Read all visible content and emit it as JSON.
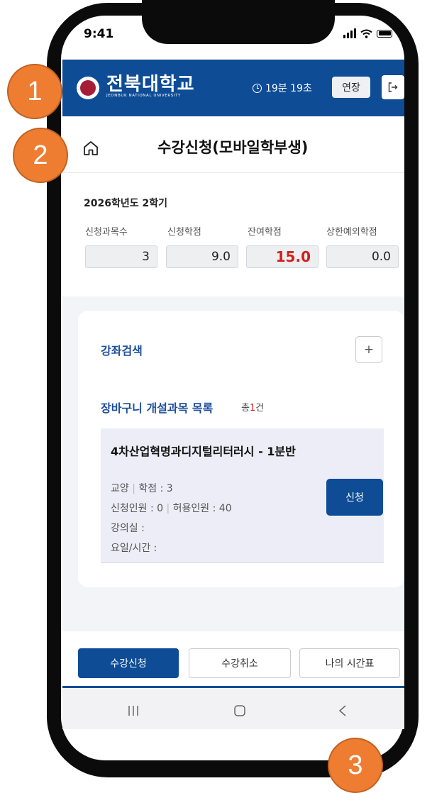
{
  "status_bar": {
    "time": "9:41"
  },
  "header": {
    "logo_name": "전북대학교",
    "logo_subtitle": "JEONBUK NATIONAL UNIVERSITY",
    "timer": "19분 19초",
    "extend_label": "연장"
  },
  "page": {
    "title": "수강신청(모바일학부생)"
  },
  "summary": {
    "semester": "2026학년도 2학기",
    "stats": [
      {
        "label": "신청과목수",
        "value": "3"
      },
      {
        "label": "신청학점",
        "value": "9.0"
      },
      {
        "label": "잔여학점",
        "value": "15.0"
      },
      {
        "label": "상한예외학점",
        "value": "0.0"
      }
    ]
  },
  "search": {
    "title": "강좌검색",
    "plus_label": "+"
  },
  "cart": {
    "title": "장바구니 개설과목 목록",
    "count_prefix": "총",
    "count": "1",
    "count_suffix": "건",
    "items": [
      {
        "name": "4차산업혁명과디지털리터러시 - 1분반",
        "category": "교양",
        "credits": "학점 : 3",
        "applicants": "신청인원 : 0",
        "capacity": "허용인원 : 40",
        "room": "강의실 :",
        "schedule": "요일/시간 :",
        "apply_label": "신청"
      }
    ]
  },
  "tabs": [
    {
      "label": "수강신청",
      "active": true
    },
    {
      "label": "수강취소",
      "active": false
    },
    {
      "label": "나의 시간표",
      "active": false
    }
  ],
  "annotations": [
    "1",
    "2",
    "3"
  ],
  "colors": {
    "header": "#0e4c96",
    "badge": "#ee7d31",
    "accent_red": "#d51e1e"
  }
}
